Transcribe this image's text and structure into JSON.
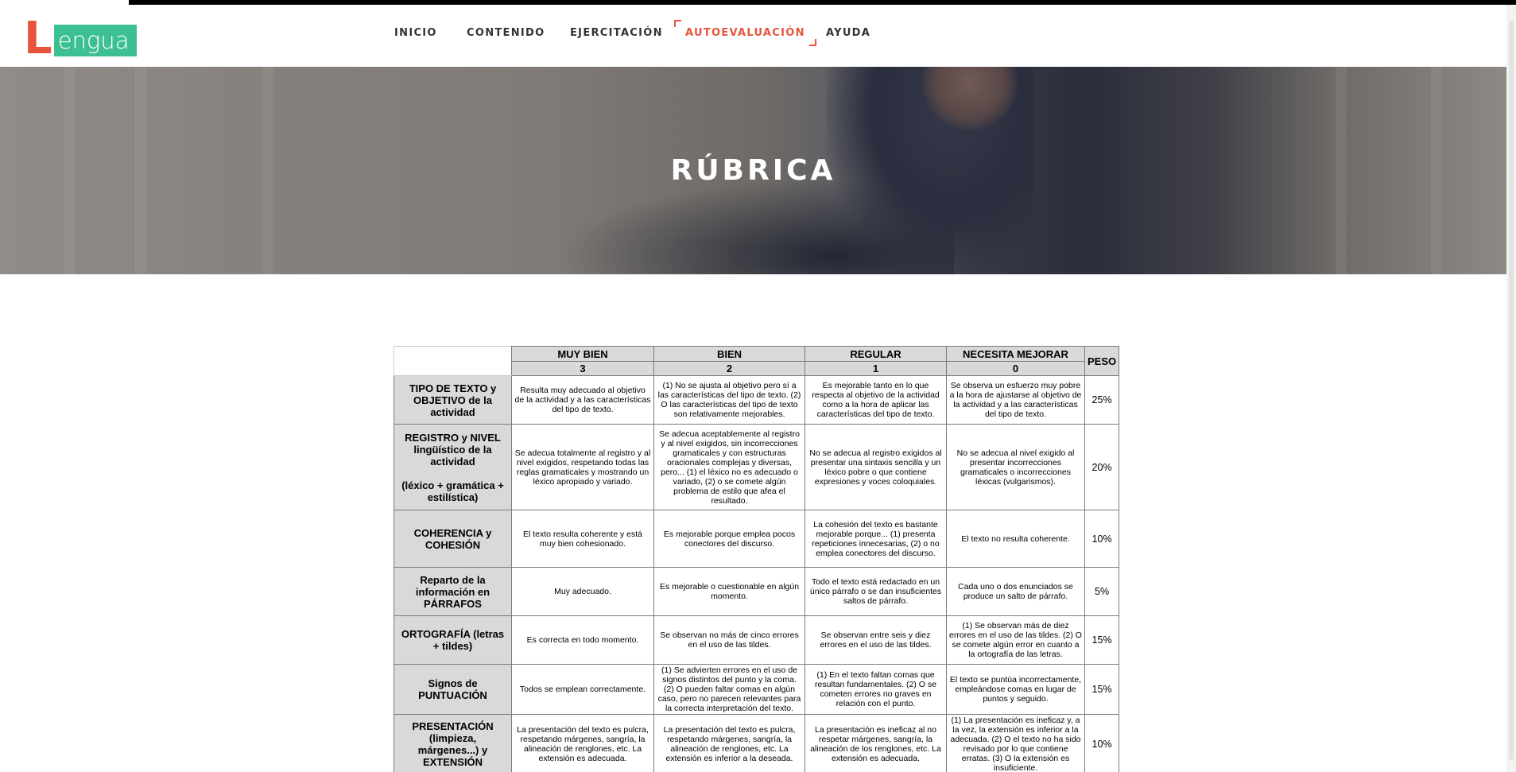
{
  "logo": {
    "letter": "L",
    "word": "engua"
  },
  "nav": {
    "items": [
      {
        "label": "INICIO",
        "active": false
      },
      {
        "label": "CONTENIDO",
        "active": false
      },
      {
        "label": "EJERCITACIÓN",
        "active": false
      },
      {
        "label": "AUTOEVALUACIÓN",
        "active": true
      },
      {
        "label": "AYUDA",
        "active": false
      }
    ],
    "active_color": "#e8543b"
  },
  "hero": {
    "title": "RÚBRICA"
  },
  "rubric": {
    "levels": [
      {
        "label": "MUY BIEN",
        "score": "3"
      },
      {
        "label": "BIEN",
        "score": "2"
      },
      {
        "label": "REGULAR",
        "score": "1"
      },
      {
        "label": "NECESITA MEJORAR",
        "score": "0"
      }
    ],
    "weight_header": "PESO",
    "rows": [
      {
        "criterion": "TIPO DE TEXTO y OBJETIVO de la actividad",
        "criterion_extra": "",
        "cells": [
          "Resulta muy adecuado al objetivo de la actividad y a las características del tipo de texto.",
          "(1) No se ajusta al objetivo pero sí a las características del tipo de texto. (2) O las características del tipo de texto son relativamente mejorables.",
          "Es mejorable tanto en lo que respecta al objetivo de la actividad como a la hora de aplicar las características del tipo de texto.",
          "Se observa un esfuerzo muy pobre a la hora de ajustarse al objetivo de la actividad y a las características del tipo de texto."
        ],
        "weight": "25%"
      },
      {
        "criterion": "REGISTRO y NIVEL lingüístico de la actividad",
        "criterion_extra": "(léxico + gramática + estilística)",
        "cells": [
          "Se adecua totalmente al registro y al nivel exigidos, respetando todas las reglas gramaticales y mostrando un léxico apropiado y variado.",
          "Se adecua aceptablemente al registro y al nivel exigidos, sin incorrecciones gramaticales y con estructuras oracionales complejas y diversas, pero... (1) el léxico no es adecuado o variado, (2) o se comete algún problema de estilo que afea el resultado.",
          "No se adecua al registro exigidos al presentar una sintaxis sencilla y un léxico pobre o que contiene expresiones y voces coloquiales.",
          "No se adecua al nivel exigido al presentar incorrecciones gramaticales o incorrecciones léxicas (vulgarismos)."
        ],
        "weight": "20%"
      },
      {
        "criterion": "COHERENCIA y COHESIÓN",
        "criterion_extra": "",
        "cells": [
          "El texto resulta coherente y está muy bien cohesionado.",
          "Es mejorable porque emplea pocos conectores del discurso.",
          "La cohesión del texto es bastante mejorable porque... (1) presenta repeticiones innecesarias, (2) o no emplea conectores del discurso.",
          "El texto no resulta coherente."
        ],
        "weight": "10%"
      },
      {
        "criterion": "Reparto de la información en PÁRRAFOS",
        "criterion_extra": "",
        "cells": [
          "Muy adecuado.",
          "Es mejorable o cuestionable en algún momento.",
          "Todo el texto está redactado en un único párrafo o se dan insuficientes saltos de párrafo.",
          "Cada uno o dos enunciados se produce un salto de párrafo."
        ],
        "weight": "5%"
      },
      {
        "criterion": "ORTOGRAFÍA (letras + tildes)",
        "criterion_extra": "",
        "cells": [
          "Es correcta en todo momento.",
          "Se observan no más de cinco errores en el uso de las tildes.",
          "Se observan entre seis y diez errores en el uso de las tildes.",
          "(1) Se observan más de diez errores en el uso de las tildes. (2) O se comete algún error en cuanto a la ortografía de las letras."
        ],
        "weight": "15%"
      },
      {
        "criterion": "Signos de PUNTUACIÓN",
        "criterion_extra": "",
        "cells": [
          "Todos se emplean correctamente.",
          "(1) Se advierten errores en el uso de signos distintos del punto y la coma. (2) O pueden faltar comas en algún caso, pero no parecen relevantes para la correcta interpretación del texto.",
          "(1) En el texto faltan comas que resultan fundamentales. (2) O se cometen errores no graves en relación con el punto.",
          "El texto se puntúa incorrectamente, empleándose comas en lugar de puntos y seguido."
        ],
        "weight": "15%"
      },
      {
        "criterion": "PRESENTACIÓN (limpieza, márgenes...) y EXTENSIÓN",
        "criterion_extra": "",
        "cells": [
          "La presentación del texto es pulcra, respetando márgenes, sangría, la alineación de renglones, etc. La extensión es adecuada.",
          "La presentación del texto es pulcra, respetando márgenes, sangría, la alineación de renglones, etc. La extensión es inferior a la deseada.",
          "La presentación es ineficaz al no respetar márgenes, sangría, la alineación de los renglones, etc. La extensión es adecuada.",
          "(1) La presentación es ineficaz y, a la vez, la extensión es inferior a la adecuada. (2) O el texto no ha sido revisado por lo que contiene erratas. (3) O la extensión es insuficiente."
        ],
        "weight": "10%"
      }
    ]
  }
}
